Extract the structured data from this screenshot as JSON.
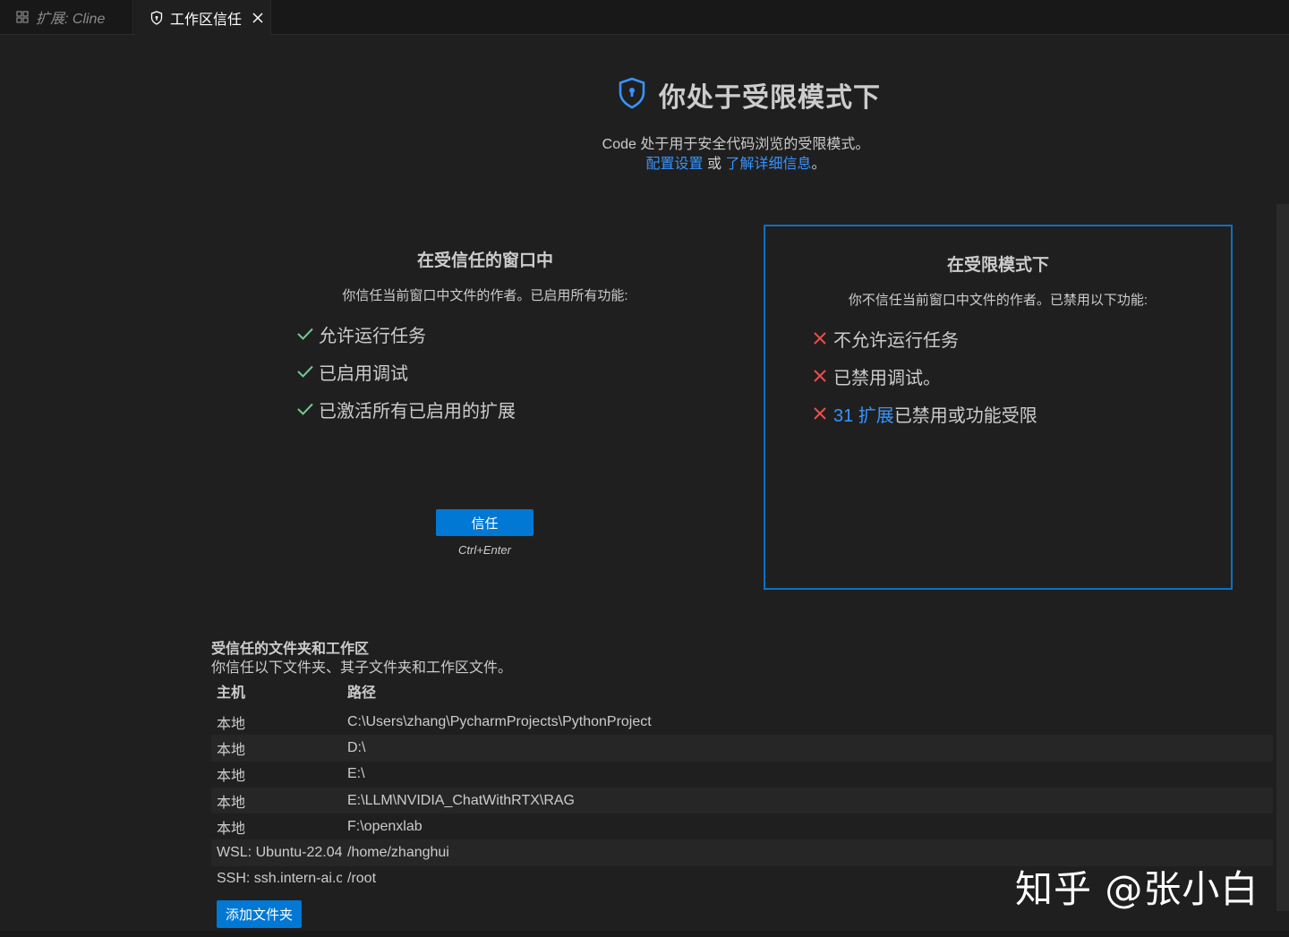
{
  "tabs": [
    {
      "label": "扩展: Cline",
      "icon": "extensions-icon"
    },
    {
      "label": "工作区信任",
      "icon": "shield-icon"
    }
  ],
  "header": {
    "title": "你处于受限模式下",
    "subtitle_text": "Code 处于用于安全代码浏览的受限模式。",
    "link_configure": "配置设置",
    "or_text": " 或 ",
    "link_learn": "了解详细信息",
    "end_text": "。"
  },
  "trusted_column": {
    "title": "在受信任的窗口中",
    "description": "你信任当前窗口中文件的作者。已启用所有功能:",
    "features": [
      "允许运行任务",
      "已启用调试",
      "已激活所有已启用的扩展"
    ],
    "button_label": "信任",
    "shortcut": "Ctrl+Enter"
  },
  "restricted_column": {
    "title": "在受限模式下",
    "description": "你不信任当前窗口中文件的作者。已禁用以下功能:",
    "features": [
      "不允许运行任务",
      "已禁用调试。"
    ],
    "extensions_link": "31 扩展",
    "extensions_text": "已禁用或功能受限"
  },
  "trusted_folders": {
    "title": "受信任的文件夹和工作区",
    "description": "你信任以下文件夹、其子文件夹和工作区文件。",
    "columns": {
      "host": "主机",
      "path": "路径"
    },
    "rows": [
      {
        "host": "本地",
        "path": "C:\\Users\\zhang\\PycharmProjects\\PythonProject"
      },
      {
        "host": "本地",
        "path": "D:\\"
      },
      {
        "host": "本地",
        "path": "E:\\"
      },
      {
        "host": "本地",
        "path": "E:\\LLM\\NVIDIA_ChatWithRTX\\RAG"
      },
      {
        "host": "本地",
        "path": "F:\\openxlab"
      },
      {
        "host": "WSL: Ubuntu-22.04",
        "path": "/home/zhanghui"
      },
      {
        "host": "SSH: ssh.intern-ai.or",
        "path": "/root"
      }
    ],
    "add_button": "添加文件夹"
  },
  "watermark": "知乎 @张小白",
  "colors": {
    "accent": "#0078d4",
    "link": "#3794ff",
    "check": "#73c991",
    "cross": "#f14c4c",
    "border": "#0e70c0"
  }
}
